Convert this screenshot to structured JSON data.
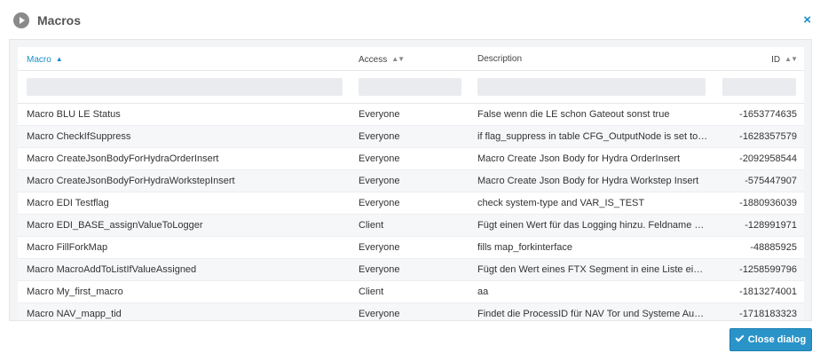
{
  "dialog": {
    "title": "Macros",
    "close_symbol": "×",
    "close_button_label": "Close dialog"
  },
  "table": {
    "columns": [
      {
        "label": "Macro",
        "sort": "ascending"
      },
      {
        "label": "Access",
        "sort": "none"
      },
      {
        "label": "Description",
        "sort": "disabled"
      },
      {
        "label": "ID",
        "sort": "none"
      }
    ],
    "filters": [
      "",
      "",
      "",
      ""
    ],
    "rows": [
      {
        "macro": "Macro BLU LE Status",
        "access": "Everyone",
        "description": "False wenn die LE schon Gateout sonst true",
        "id": "-1653774635"
      },
      {
        "macro": "Macro CheckIfSuppress",
        "access": "Everyone",
        "description": "if flag_suppress in table CFG_OutputNode is set to true",
        "id": "-1628357579"
      },
      {
        "macro": "Macro CreateJsonBodyForHydraOrderInsert",
        "access": "Everyone",
        "description": "Macro Create Json Body for Hydra OrderInsert",
        "id": "-2092958544"
      },
      {
        "macro": "Macro CreateJsonBodyForHydraWorkstepInsert",
        "access": "Everyone",
        "description": "Macro Create Json Body for Hydra Workstep Insert",
        "id": "-575447907"
      },
      {
        "macro": "Macro EDI Testflag",
        "access": "Everyone",
        "description": "check system-type and VAR_IS_TEST",
        "id": "-1880936039"
      },
      {
        "macro": "Macro EDI_BASE_assignValueToLogger",
        "access": "Client",
        "description": "Fügt einen Wert für das Logging hinzu. Feldname und Wert",
        "id": "-128991971"
      },
      {
        "macro": "Macro FillForkMap",
        "access": "Everyone",
        "description": "fills map_forkinterface",
        "id": "-48885925"
      },
      {
        "macro": "Macro MacroAddToListIfValueAssigned",
        "access": "Everyone",
        "description": "Fügt den Wert eines FTX Segment in eine Liste ein wenn",
        "id": "-1258599796"
      },
      {
        "macro": "Macro My_first_macro",
        "access": "Client",
        "description": "aa",
        "id": "-1813274001"
      },
      {
        "macro": "Macro NAV_mapp_tid",
        "access": "Everyone",
        "description": "Findet die ProcessID für NAV Tor und Systeme Auswahl",
        "id": "-1718183323"
      }
    ]
  },
  "colors": {
    "accent": "#1a8fc7",
    "button": "#2a94c9",
    "row_alt": "#f6f7f9",
    "panel": "#f3f4f6"
  },
  "icons": {
    "header": "play-circle-icon",
    "close": "close-icon",
    "sort_ascending": "sort-ascending-icon",
    "sort_both": "sort-both-icon",
    "button": "check-icon"
  }
}
